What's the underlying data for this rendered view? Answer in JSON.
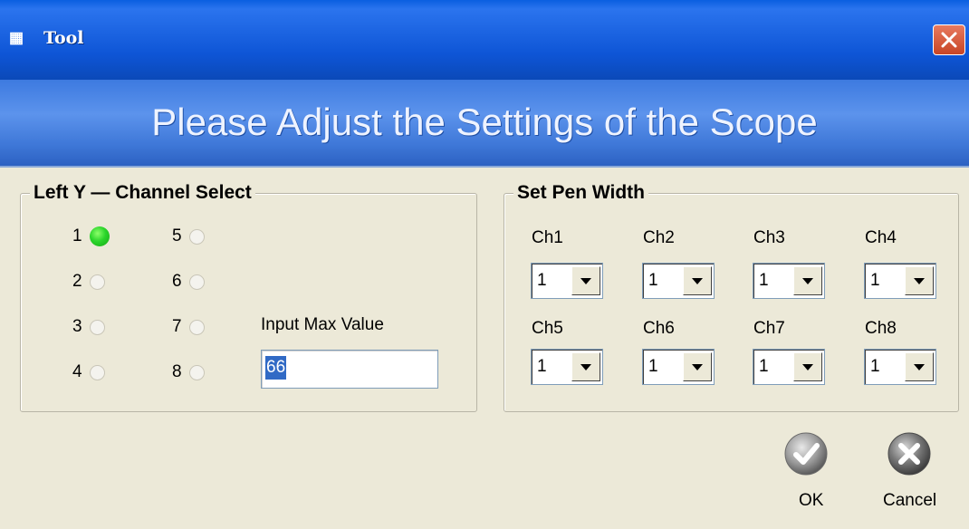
{
  "window": {
    "title": "Tool",
    "icon": "app-icon"
  },
  "banner": {
    "text": "Please Adjust the Settings of the Scope"
  },
  "channel_select": {
    "legend": "Left Y — Channel Select",
    "selected": "1",
    "channels": [
      "1",
      "2",
      "3",
      "4",
      "5",
      "6",
      "7",
      "8"
    ],
    "max_label": "Input Max Value",
    "max_value": "66"
  },
  "pen_width": {
    "legend": "Set Pen Width",
    "channels": [
      {
        "label": "Ch1",
        "value": "1"
      },
      {
        "label": "Ch2",
        "value": "1"
      },
      {
        "label": "Ch3",
        "value": "1"
      },
      {
        "label": "Ch4",
        "value": "1"
      },
      {
        "label": "Ch5",
        "value": "1"
      },
      {
        "label": "Ch6",
        "value": "1"
      },
      {
        "label": "Ch7",
        "value": "1"
      },
      {
        "label": "Ch8",
        "value": "1"
      }
    ]
  },
  "buttons": {
    "ok": "OK",
    "cancel": "Cancel"
  },
  "colors": {
    "selected_radio": "#2bd52b",
    "titlebar": "#0e55d6",
    "close": "#c84525"
  }
}
